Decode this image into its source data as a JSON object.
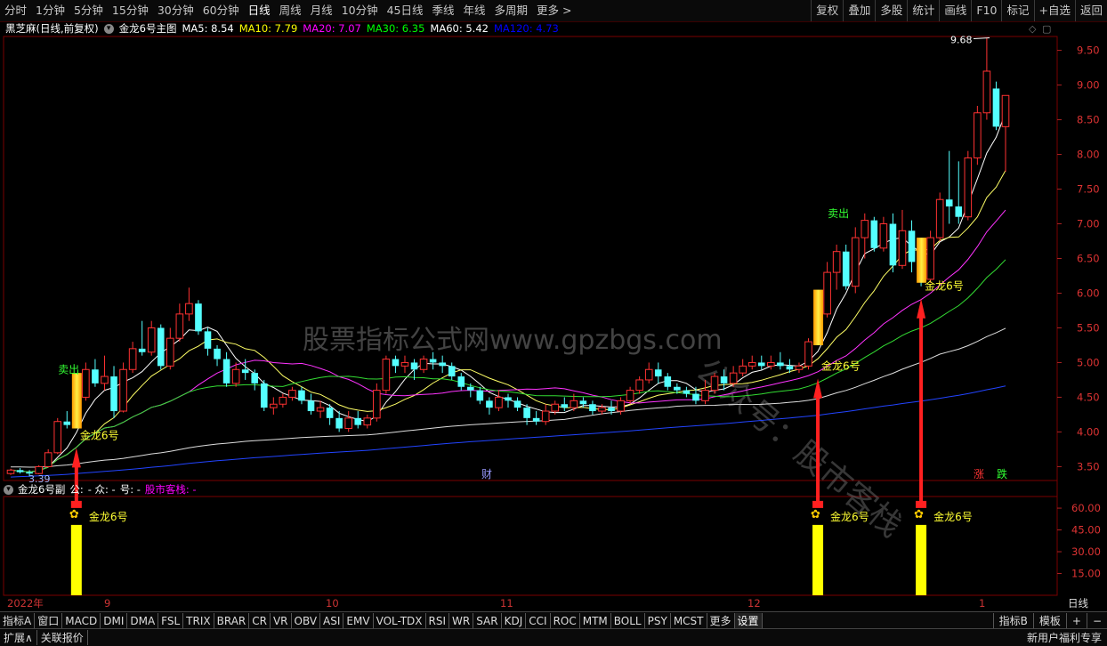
{
  "toolbar": {
    "periods": [
      "分时",
      "1分钟",
      "5分钟",
      "15分钟",
      "30分钟",
      "60分钟",
      "日线",
      "周线",
      "月线",
      "10分钟",
      "45日线",
      "季线",
      "年线",
      "多周期",
      "更多 >"
    ],
    "active_index": 6,
    "right_buttons": [
      "复权",
      "叠加",
      "多股",
      "统计",
      "画线",
      "F10",
      "标记",
      "+自选",
      "返回"
    ]
  },
  "main_info": {
    "stock": "黑芝麻(日线,前复权)",
    "indicator": "金龙6号主图",
    "ma": [
      {
        "label": "MA5: 8.54",
        "color": "#ffffff"
      },
      {
        "label": "MA10: 7.79",
        "color": "#ffff00"
      },
      {
        "label": "MA20: 7.07",
        "color": "#ff00ff"
      },
      {
        "label": "MA30: 6.35",
        "color": "#00ff00"
      },
      {
        "label": "MA60: 5.42",
        "color": "#ffffff"
      },
      {
        "label": "MA120: 4.73",
        "color": "#0000ff"
      }
    ]
  },
  "sub_info": {
    "name": "金龙6号副",
    "items": [
      {
        "label": "公:",
        "color": "#ffffff"
      },
      {
        "label": "- 众: -",
        "color": "#ffffff"
      },
      {
        "label": "号: -",
        "color": "#ffffff"
      },
      {
        "label": "股市客栈: -",
        "color": "#ff00ff"
      }
    ]
  },
  "chart_data": {
    "type": "candlestick",
    "ylim": [
      3.3,
      9.7
    ],
    "y_ticks": [
      "9.50",
      "9.00",
      "8.50",
      "8.00",
      "7.50",
      "7.00",
      "6.50",
      "6.00",
      "5.50",
      "5.00",
      "4.50",
      "4.00",
      "3.50"
    ],
    "candles": [
      [
        3.4,
        3.45,
        3.38,
        3.47
      ],
      [
        3.45,
        3.42,
        3.4,
        3.48
      ],
      [
        3.42,
        3.4,
        3.36,
        3.45
      ],
      [
        3.4,
        3.5,
        3.39,
        3.52
      ],
      [
        3.5,
        3.7,
        3.49,
        3.75
      ],
      [
        3.7,
        4.15,
        3.68,
        4.2
      ],
      [
        4.15,
        4.1,
        4.05,
        4.3
      ],
      [
        4.1,
        4.5,
        4.08,
        4.55
      ],
      [
        4.5,
        4.9,
        4.45,
        5.0
      ],
      [
        4.9,
        4.7,
        4.65,
        5.05
      ],
      [
        4.7,
        4.8,
        4.6,
        5.1
      ],
      [
        4.8,
        4.3,
        4.2,
        4.95
      ],
      [
        4.3,
        4.9,
        4.28,
        5.0
      ],
      [
        4.9,
        5.2,
        4.85,
        5.3
      ],
      [
        5.2,
        5.15,
        5.1,
        5.6
      ],
      [
        5.15,
        5.5,
        5.1,
        5.6
      ],
      [
        5.5,
        4.95,
        4.9,
        5.55
      ],
      [
        4.95,
        5.35,
        4.9,
        5.5
      ],
      [
        5.35,
        5.7,
        5.3,
        5.85
      ],
      [
        5.7,
        5.85,
        5.6,
        6.08
      ],
      [
        5.85,
        5.45,
        5.4,
        5.9
      ],
      [
        5.45,
        5.2,
        5.1,
        5.5
      ],
      [
        5.2,
        5.05,
        4.95,
        5.25
      ],
      [
        5.05,
        4.7,
        4.65,
        5.15
      ],
      [
        4.7,
        4.9,
        4.65,
        5.0
      ],
      [
        4.9,
        4.85,
        4.75,
        5.05
      ],
      [
        4.85,
        4.7,
        4.6,
        4.9
      ],
      [
        4.7,
        4.35,
        4.3,
        4.75
      ],
      [
        4.35,
        4.4,
        4.25,
        4.5
      ],
      [
        4.4,
        4.5,
        4.35,
        4.55
      ],
      [
        4.5,
        4.6,
        4.45,
        4.65
      ],
      [
        4.6,
        4.45,
        4.4,
        4.65
      ],
      [
        4.45,
        4.3,
        4.25,
        4.55
      ],
      [
        4.3,
        4.35,
        4.2,
        4.45
      ],
      [
        4.35,
        4.2,
        4.1,
        4.4
      ],
      [
        4.2,
        4.05,
        4.0,
        4.3
      ],
      [
        4.05,
        4.2,
        4.0,
        4.3
      ],
      [
        4.2,
        4.1,
        4.05,
        4.3
      ],
      [
        4.1,
        4.2,
        4.05,
        4.25
      ],
      [
        4.2,
        4.6,
        4.15,
        4.7
      ],
      [
        4.6,
        5.05,
        4.55,
        5.1
      ],
      [
        5.05,
        4.95,
        4.85,
        5.1
      ],
      [
        4.95,
        5.0,
        4.85,
        5.1
      ],
      [
        5.0,
        4.9,
        4.75,
        5.05
      ],
      [
        4.9,
        5.05,
        4.85,
        5.1
      ],
      [
        5.05,
        5.0,
        4.9,
        5.15
      ],
      [
        5.0,
        4.95,
        4.85,
        5.1
      ],
      [
        4.95,
        4.8,
        4.75,
        5.0
      ],
      [
        4.8,
        4.65,
        4.6,
        4.85
      ],
      [
        4.65,
        4.6,
        4.5,
        4.7
      ],
      [
        4.6,
        4.45,
        4.4,
        4.65
      ],
      [
        4.45,
        4.35,
        4.25,
        4.5
      ],
      [
        4.35,
        4.5,
        4.3,
        4.6
      ],
      [
        4.5,
        4.45,
        4.35,
        4.55
      ],
      [
        4.45,
        4.35,
        4.3,
        4.5
      ],
      [
        4.35,
        4.2,
        4.1,
        4.4
      ],
      [
        4.2,
        4.15,
        4.1,
        4.3
      ],
      [
        4.15,
        4.3,
        4.1,
        4.4
      ],
      [
        4.3,
        4.4,
        4.25,
        4.45
      ],
      [
        4.4,
        4.35,
        4.3,
        4.5
      ],
      [
        4.35,
        4.45,
        4.3,
        4.55
      ],
      [
        4.45,
        4.4,
        4.35,
        4.5
      ],
      [
        4.4,
        4.3,
        4.25,
        4.45
      ],
      [
        4.3,
        4.35,
        4.25,
        4.4
      ],
      [
        4.35,
        4.3,
        4.25,
        4.45
      ],
      [
        4.3,
        4.45,
        4.25,
        4.5
      ],
      [
        4.45,
        4.6,
        4.4,
        4.65
      ],
      [
        4.6,
        4.75,
        4.55,
        4.8
      ],
      [
        4.75,
        4.9,
        4.7,
        5.0
      ],
      [
        4.9,
        4.8,
        4.7,
        5.0
      ],
      [
        4.8,
        4.65,
        4.6,
        4.85
      ],
      [
        4.65,
        4.6,
        4.55,
        4.7
      ],
      [
        4.6,
        4.55,
        4.5,
        4.65
      ],
      [
        4.55,
        4.45,
        4.4,
        4.65
      ],
      [
        4.45,
        4.6,
        4.4,
        4.75
      ],
      [
        4.6,
        4.8,
        4.55,
        4.85
      ],
      [
        4.8,
        4.7,
        4.6,
        4.9
      ],
      [
        4.7,
        4.85,
        4.65,
        4.95
      ],
      [
        4.85,
        4.95,
        4.8,
        5.05
      ],
      [
        4.95,
        5.0,
        4.9,
        5.1
      ],
      [
        5.0,
        4.95,
        4.9,
        5.1
      ],
      [
        4.95,
        5.0,
        4.9,
        5.1
      ],
      [
        5.0,
        4.95,
        4.9,
        5.15
      ],
      [
        4.95,
        4.9,
        4.85,
        5.05
      ],
      [
        4.9,
        4.95,
        4.85,
        5.0
      ],
      [
        4.95,
        5.3,
        4.9,
        5.35
      ],
      [
        5.3,
        5.7,
        5.25,
        5.75
      ],
      [
        5.7,
        6.3,
        5.65,
        6.45
      ],
      [
        6.3,
        6.6,
        6.05,
        6.7
      ],
      [
        6.6,
        6.1,
        6.05,
        6.7
      ],
      [
        6.1,
        6.8,
        6.0,
        6.95
      ],
      [
        6.8,
        7.05,
        6.5,
        7.15
      ],
      [
        7.05,
        6.65,
        6.6,
        7.1
      ],
      [
        6.65,
        7.0,
        6.6,
        7.1
      ],
      [
        7.0,
        6.4,
        6.3,
        7.15
      ],
      [
        6.4,
        6.9,
        6.35,
        7.2
      ],
      [
        6.9,
        6.45,
        6.3,
        7.05
      ],
      [
        6.45,
        6.2,
        6.1,
        6.5
      ],
      [
        6.2,
        6.8,
        6.15,
        6.9
      ],
      [
        6.8,
        7.35,
        6.75,
        7.45
      ],
      [
        7.35,
        7.25,
        7.0,
        8.05
      ],
      [
        7.25,
        7.1,
        7.0,
        7.9
      ],
      [
        7.1,
        7.95,
        7.05,
        8.05
      ],
      [
        7.95,
        8.6,
        7.85,
        8.7
      ],
      [
        8.6,
        9.2,
        8.5,
        9.68
      ],
      [
        8.95,
        8.4,
        8.35,
        9.05
      ],
      [
        8.4,
        8.85,
        7.75,
        8.85
      ]
    ],
    "annotations": [
      {
        "type": "signal",
        "label": "金龙6号",
        "price": 3.95
      },
      {
        "type": "signal",
        "label": "金龙6号",
        "price": 4.95
      },
      {
        "type": "signal",
        "label": "金龙6号",
        "price": 6.1
      },
      {
        "type": "sell",
        "label": "卖出",
        "price": 5.0
      },
      {
        "type": "sell",
        "label": "卖出",
        "price": 7.25
      },
      {
        "type": "max",
        "label": "9.68"
      },
      {
        "type": "min",
        "label": "3.39"
      },
      {
        "type": "tag",
        "label": "财"
      },
      {
        "type": "tag",
        "label": "涨",
        "color": "#ff3333"
      },
      {
        "type": "tag",
        "label": "跌",
        "color": "#33ff33"
      }
    ],
    "sub_chart": {
      "y_ticks": [
        "60.00",
        "45.00",
        "30.00",
        "15.00"
      ],
      "ylim": [
        0,
        68
      ],
      "signals": [
        {
          "label": "金龙6号",
          "value": 65
        },
        {
          "label": "金龙6号",
          "value": 65
        },
        {
          "label": "金龙6号",
          "value": 65
        }
      ]
    },
    "x_labels": [
      "2022年",
      "9",
      "10",
      "11",
      "12",
      "1"
    ],
    "period_label": "日线",
    "watermarks": [
      "股票指标公式网www.gpzbgs.com",
      "公众号：股市客栈"
    ]
  },
  "tabs": {
    "items": [
      "指标A",
      "窗口",
      "MACD",
      "DMI",
      "DMA",
      "FSL",
      "TRIX",
      "BRAR",
      "CR",
      "VR",
      "OBV",
      "ASI",
      "EMV",
      "VOL-TDX",
      "RSI",
      "WR",
      "SAR",
      "KDJ",
      "CCI",
      "ROC",
      "MTM",
      "BOLL",
      "PSY",
      "MCST",
      "更多",
      "设置"
    ],
    "right": [
      "指标B",
      "模板",
      "+",
      "−"
    ]
  },
  "bottom_bar": {
    "left": [
      "扩展∧",
      "关联报价"
    ],
    "right": "新用户福利专享"
  }
}
